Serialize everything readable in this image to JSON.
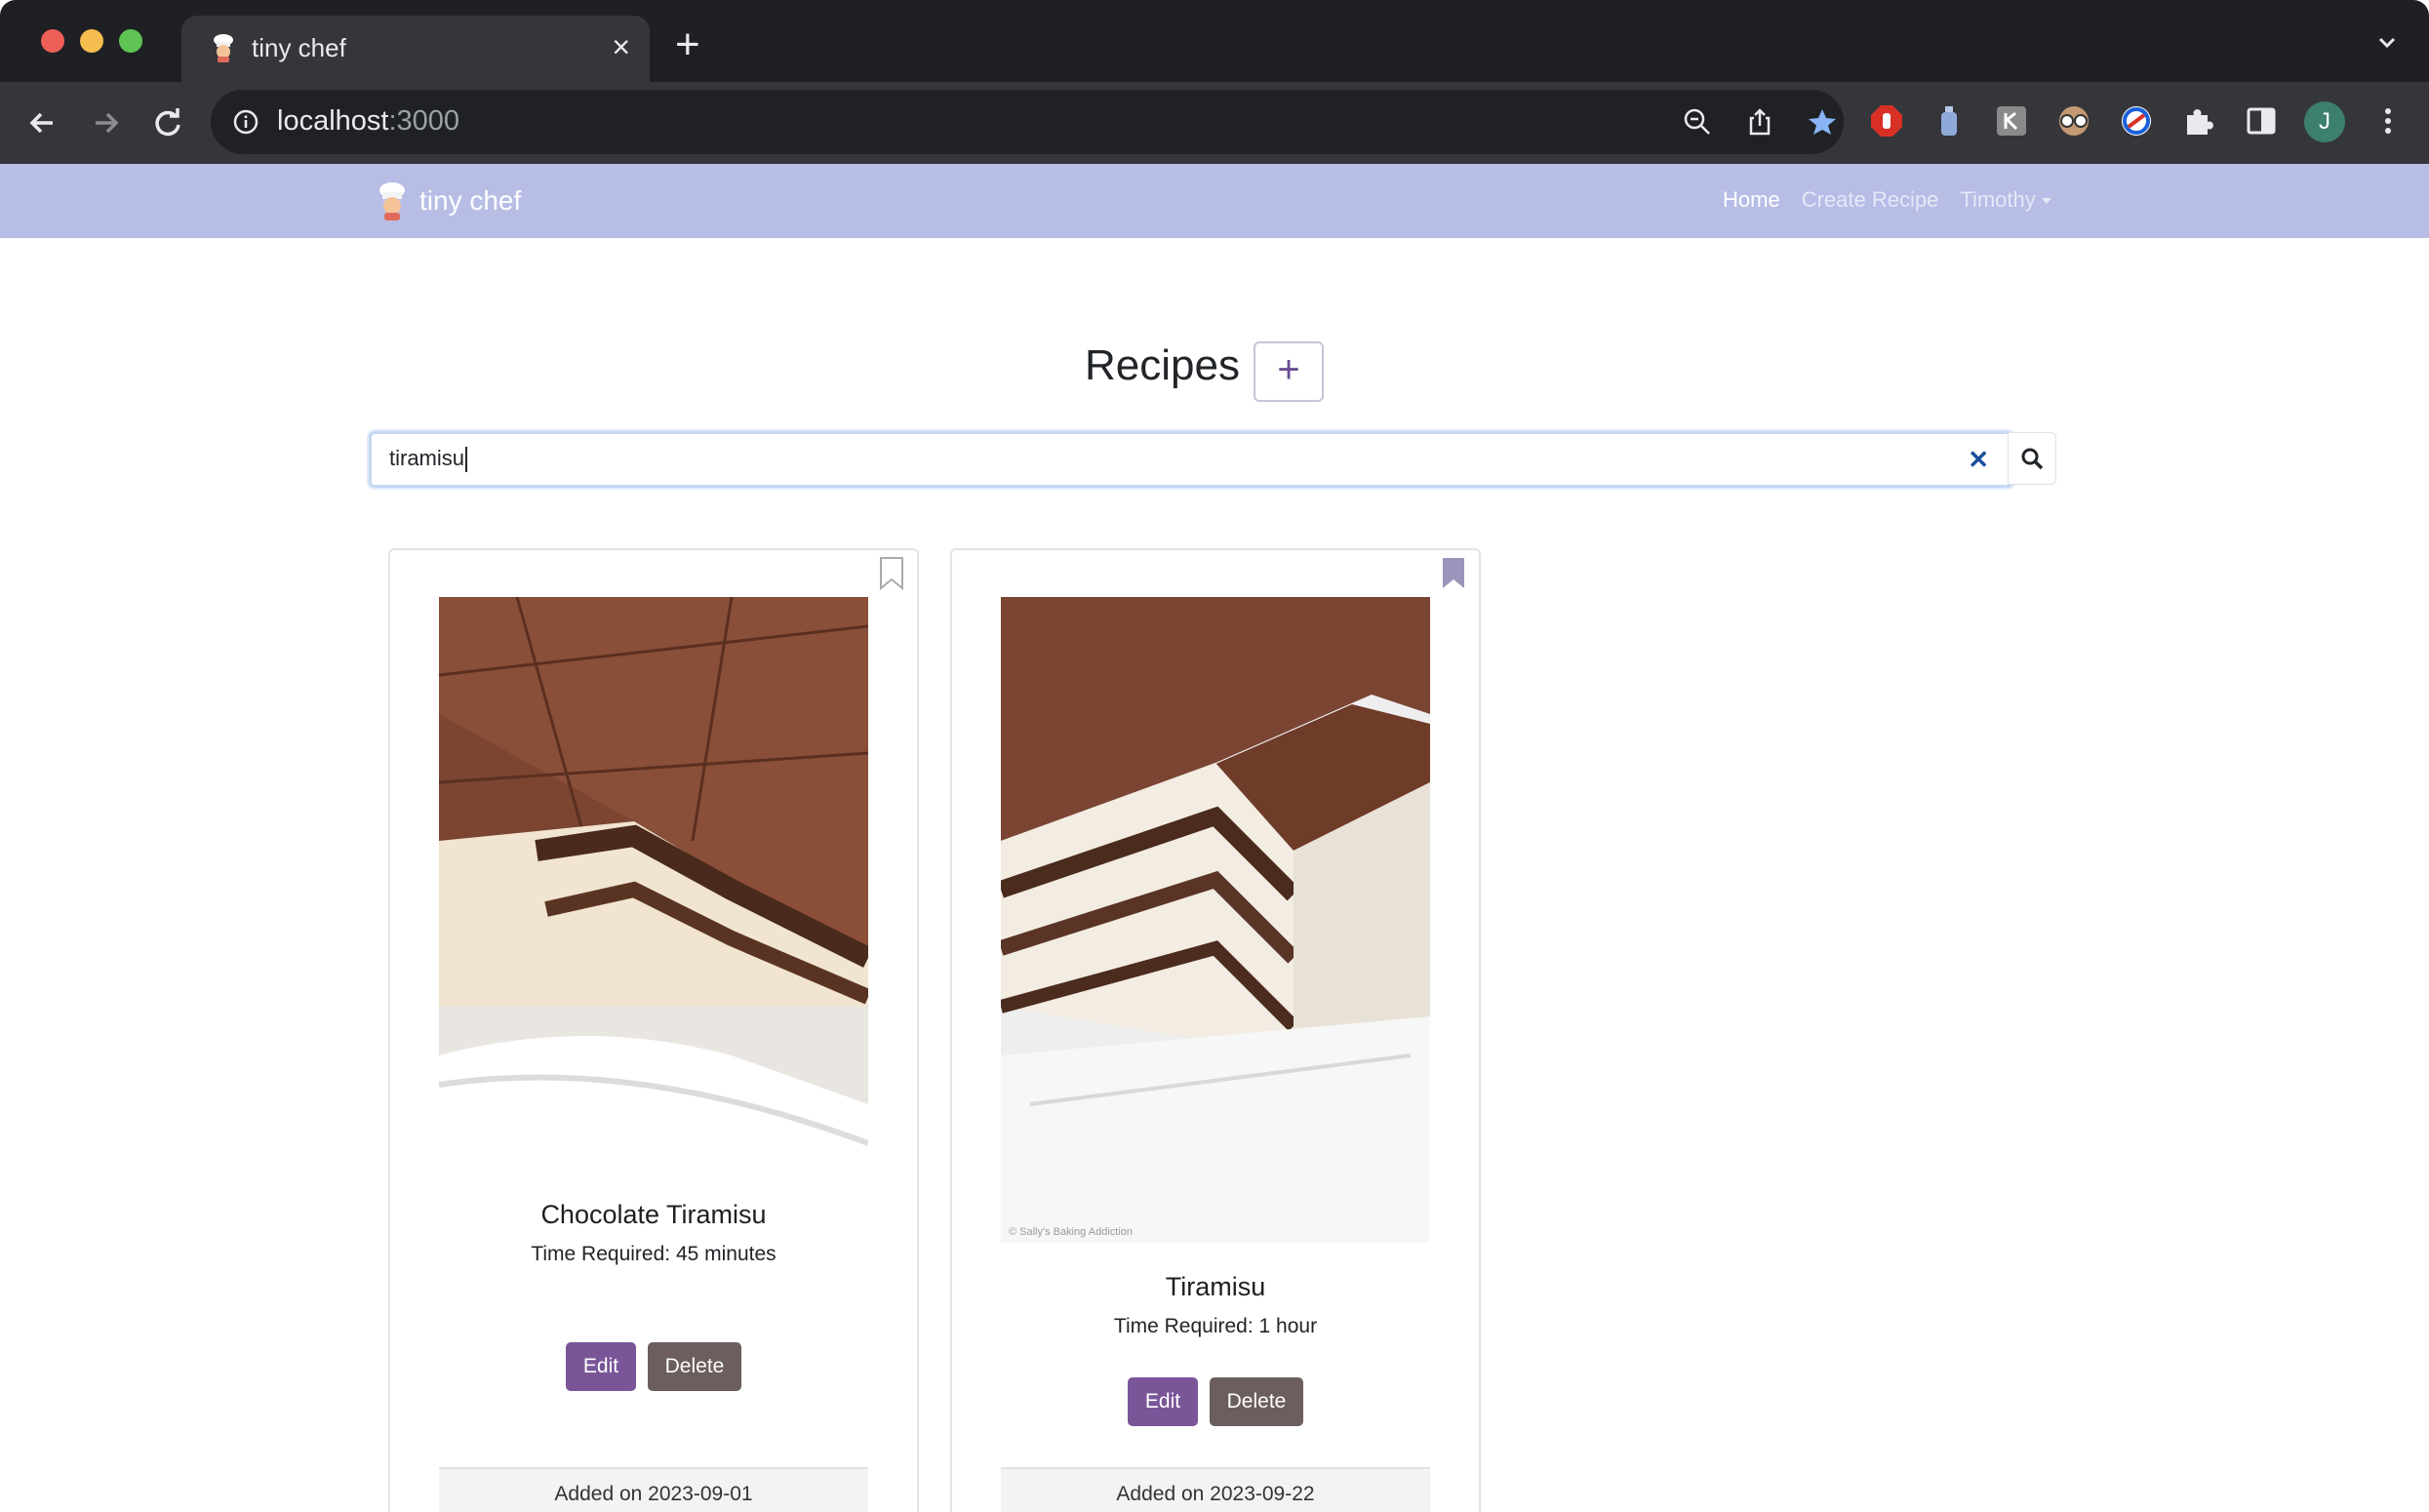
{
  "browser": {
    "tab_title": "tiny chef",
    "url_host": "localhost",
    "url_port": ":3000",
    "profile_initial": "J"
  },
  "navbar": {
    "brand": "tiny chef",
    "links": {
      "home": "Home",
      "create": "Create Recipe",
      "user": "Timothy"
    }
  },
  "main": {
    "title": "Recipes",
    "add_label": "+",
    "search": {
      "value": "tiramisu",
      "clear_label": "✕"
    }
  },
  "cards": [
    {
      "title": "Chocolate Tiramisu",
      "time": "Time Required: 45 minutes",
      "edit": "Edit",
      "delete": "Delete",
      "added": "Added on 2023-09-01",
      "bookmarked": false
    },
    {
      "title": "Tiramisu",
      "time": "Time Required: 1 hour",
      "edit": "Edit",
      "delete": "Delete",
      "added": "Added on 2023-09-22",
      "bookmarked": true,
      "photo_credit": "© Sally's Baking Addiction"
    }
  ],
  "colors": {
    "navbar": "#b8bde6",
    "primary": "#7a5699",
    "secondary": "#6b5e5c"
  }
}
